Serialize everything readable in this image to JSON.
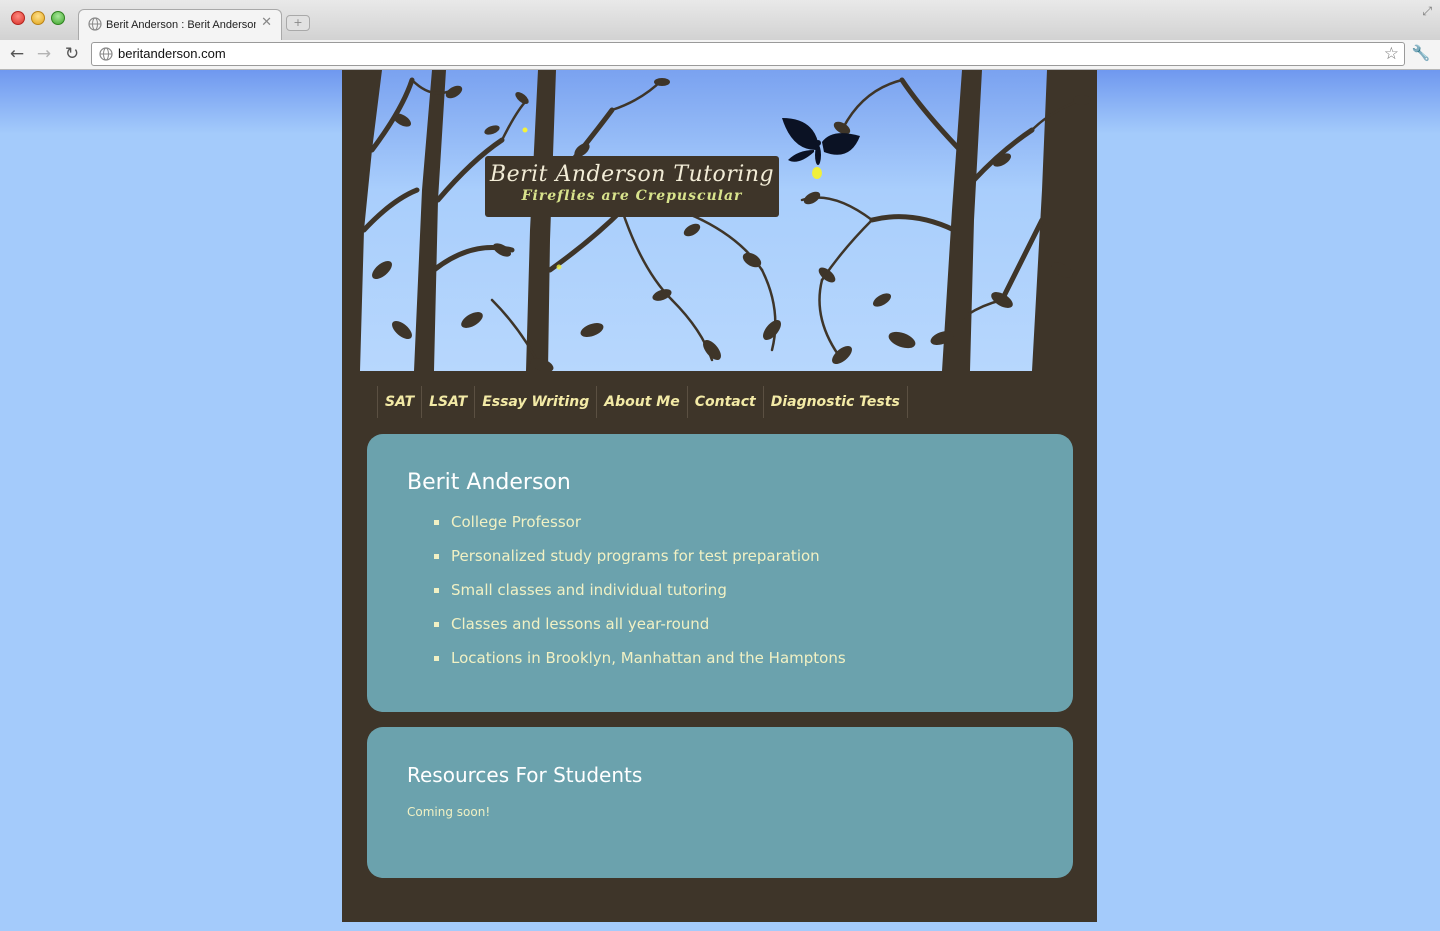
{
  "browser": {
    "tab_title": "Berit Anderson : Berit Anderson Tutoring",
    "url": "beritanderson.com"
  },
  "header": {
    "title": "Berit Anderson Tutoring",
    "tagline": "Fireflies are Crepuscular"
  },
  "nav": {
    "items": [
      {
        "label": "SAT"
      },
      {
        "label": "LSAT"
      },
      {
        "label": "Essay Writing"
      },
      {
        "label": "About Me"
      },
      {
        "label": "Contact"
      },
      {
        "label": "Diagnostic Tests"
      }
    ]
  },
  "main": {
    "heading": "Berit Anderson",
    "bullets": [
      "College Professor",
      "Personalized study programs for test preparation",
      "Small classes and individual tutoring",
      "Classes and lessons all year-round",
      "Locations in Brooklyn, Manhattan and the Hamptons"
    ]
  },
  "resources": {
    "heading": "Resources For Students",
    "text": "Coming soon!"
  },
  "colors": {
    "page_bg": "#a4cbfb",
    "site_bg": "#3e3529",
    "panel_bg": "#6ba2ad",
    "nav_text": "#f3eaa6",
    "tagline": "#d8e38c"
  }
}
